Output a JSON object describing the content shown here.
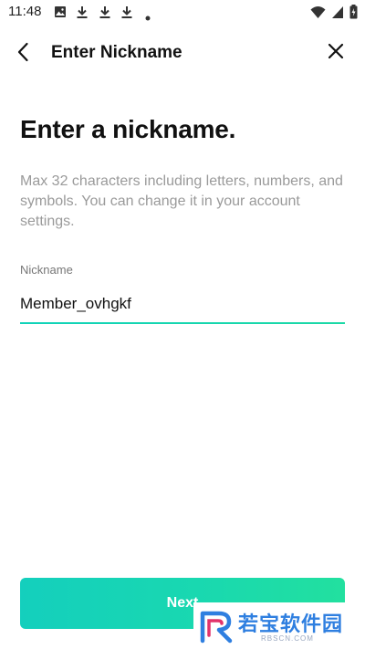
{
  "status_bar": {
    "time": "11:48",
    "notification_icons": [
      "image-icon",
      "download-icon",
      "download-icon",
      "download-icon",
      "dot-icon"
    ],
    "system_icons": [
      "wifi-icon",
      "signal-icon",
      "battery-charging-icon"
    ]
  },
  "app_bar": {
    "title": "Enter Nickname",
    "back_icon": "back-arrow-icon",
    "close_icon": "close-icon"
  },
  "main": {
    "heading": "Enter a nickname.",
    "description": "Max 32 characters including letters, numbers, and symbols. You can change it in your account settings.",
    "nickname_field": {
      "label": "Nickname",
      "value": "Member_ovhgkf"
    }
  },
  "footer": {
    "next_label": "Next"
  },
  "watermark": {
    "text": "若宝软件园",
    "sub": "RBSCN.COM"
  },
  "colors": {
    "accent": "#19d6b2",
    "accent_end": "#22e09f",
    "watermark_blue": "#2f7fe0"
  }
}
